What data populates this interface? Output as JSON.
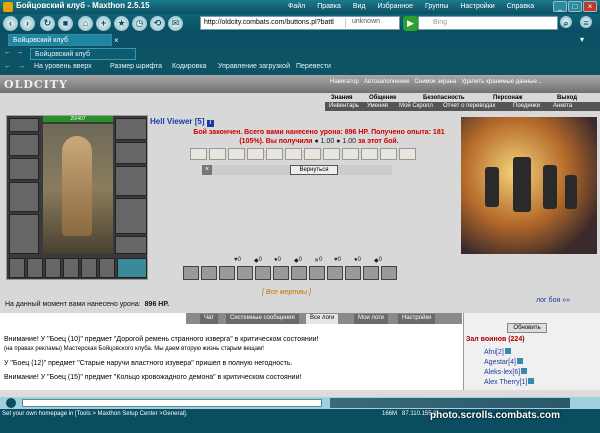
{
  "window": {
    "title": "Бойцовский клуб - Maxthon 2.5.15"
  },
  "menu": [
    "Файл",
    "Правка",
    "Вид",
    "Избранное",
    "Группы",
    "Настройки",
    "Справка"
  ],
  "address": {
    "url": "http://oldcity.combats.com/buttons.pl?battl",
    "security": "unknown"
  },
  "search": {
    "engine": "Bing"
  },
  "tabs": [
    {
      "label": "Бойцовский клуб"
    },
    {
      "label": "Бойцовский клуб"
    }
  ],
  "toolbar": {
    "up": "На уровень вверх",
    "font": "Размер шрифта",
    "encoding": "Кодировка",
    "downloads": "Управление загрузкой",
    "translate": "Перевести"
  },
  "favbar": {
    "navigator": "Навигатор",
    "autofill": "Автозаполнение",
    "snapshot": "Снимок экрана",
    "delete": "Удалить хранимые данные..."
  },
  "site": {
    "logo": "OLDCITY",
    "menu": [
      "Знания",
      "Общение",
      "Безопасность",
      "Персонаж",
      "Выход"
    ],
    "submenu": [
      "Инвентарь",
      "Умения",
      "Мой Скролл",
      "Отчет о переводах",
      "Поединки",
      "Анкета"
    ],
    "hp": "20/407",
    "player": "Hell Viewer [5]",
    "battle_msg_1": "Бой закончен. Всего вами нанесено урона: 896 HP. Получено опыта: 181",
    "battle_msg_2": "(105%). Вы получили",
    "battle_msg_3": "за этот бой.",
    "battle_reward_1": "1.00",
    "battle_reward_2": "1.00",
    "back_label": "Вернуться",
    "stats": [
      "0",
      "0",
      "0",
      "0",
      "0",
      "0",
      "0",
      "0"
    ],
    "deaths_link": "[ Все мертвы ]",
    "damage_label": "На данный момент вами нанесено урона:",
    "damage_value": "896 HP.",
    "log_link": "лог боя »»"
  },
  "chat": {
    "tabs": [
      "Чат",
      "Системные сообщения",
      "Все логи",
      "Мои логи",
      "Настройки"
    ],
    "active_tab": "Все логи",
    "lines": [
      "Внимание! У \"Боец (10)\" предмет \"Дорогой ремень странного изверга\" в критическом состоянии!",
      "(на правах рекламы) Мастерская Бойцовского клуба. Мы даем вторую жизнь старым вещам!",
      "У \"Боец (12)\" предмет \"Старые наручи властного изувера\" пришел в полную негодность.",
      "Внимание! У \"Боец (15)\" предмет \"Кольцо кровожадного демона\" в критическом состоянии!"
    ],
    "refresh_label": "Обновить",
    "hall_label": "Зал воинов (224)",
    "players": [
      "Afni[2]",
      "Agestar[4]",
      "Aleks-lex[6]",
      "Alex Therry[1]"
    ]
  },
  "status": {
    "home": "Set your own homepage in [Tools > Maxthon Setup Center >General].",
    "mem": "166M",
    "ip": "87.110.155.2"
  },
  "watermark": "photo.scrolls.combats.com"
}
